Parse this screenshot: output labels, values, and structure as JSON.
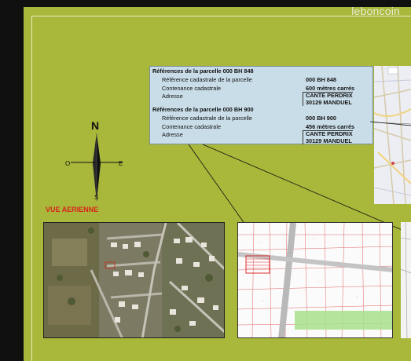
{
  "watermark": "leboncoin",
  "parcels": [
    {
      "title": "Références de la parcelle 000 BH 848",
      "rows": [
        {
          "label": "Référence cadastrale de la parcelle",
          "value": "000 BH 848"
        },
        {
          "label": "Contenance cadastrale",
          "value": "600 mètres carrés"
        },
        {
          "label": "Adresse",
          "value": "CANTE PERDRIX",
          "value2": "30129 MANDUEL"
        }
      ]
    },
    {
      "title": "Références de la parcelle 000 BH 900",
      "rows": [
        {
          "label": "Référence cadastrale de la parcelle",
          "value": "000 BH 900"
        },
        {
          "label": "Contenance cadastrale",
          "value": "456 mètres carrés"
        },
        {
          "label": "Adresse",
          "value": "CANTE PERDRIX",
          "value2": "30129 MANDUEL"
        }
      ]
    }
  ],
  "compass": {
    "n": "N",
    "s": "S",
    "e": "E",
    "o": "O"
  },
  "aerial_label": "VUE AERIENNE",
  "colors": {
    "background": "#a9b73a",
    "panel": "#c9dde8",
    "label_red": "#d8261c"
  }
}
